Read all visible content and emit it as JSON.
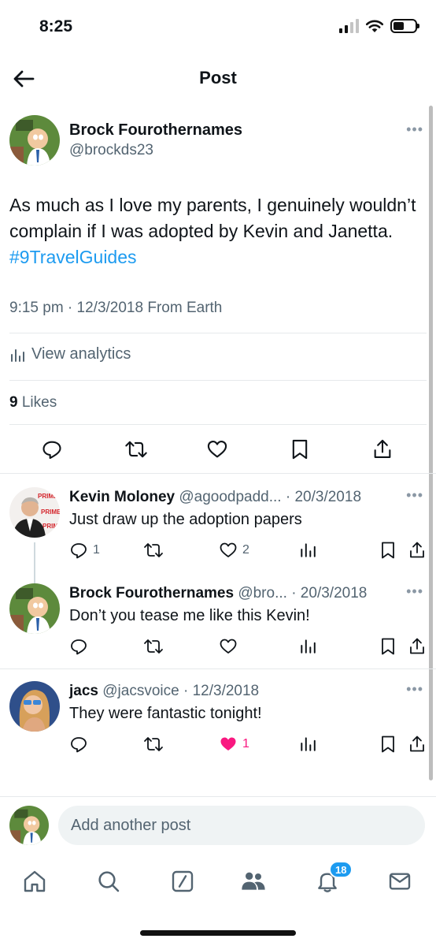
{
  "status_bar": {
    "time": "8:25",
    "signal_icon": "cellular-signal-icon",
    "wifi_icon": "wifi-icon",
    "battery_icon": "battery-icon"
  },
  "header": {
    "title": "Post",
    "back_icon": "arrow-left-icon"
  },
  "post": {
    "author_name": "Brock Fourothernames",
    "author_handle": "@brockds23",
    "text_before": "As much as I love my parents, I genuinely wouldn’t complain if I was adopted by Kevin and Janetta. ",
    "hashtag": "#9TravelGuides",
    "meta": "9:15 pm · 12/3/2018 From Earth",
    "analytics_label": "View analytics",
    "likes_count": "9",
    "likes_label": " Likes",
    "more_label": "•••"
  },
  "replies": [
    {
      "name": "Kevin Moloney",
      "handle": "@agoodpadd...",
      "date": " · 20/3/2018",
      "text": "Just draw up the adoption papers",
      "reply_count": "1",
      "like_count": "2",
      "liked": false,
      "more_label": "•••"
    },
    {
      "name": "Brock Fourothernames",
      "handle": "@bro...",
      "date": " · 20/3/2018",
      "text": "Don’t you tease me like this Kevin!",
      "reply_count": "",
      "like_count": "",
      "liked": false,
      "more_label": "•••"
    },
    {
      "name": "jacs",
      "handle": "@jacsvoice",
      "date": " · 12/3/2018",
      "text": "They were fantastic tonight!",
      "reply_count": "",
      "like_count": "1",
      "liked": true,
      "more_label": "•••"
    }
  ],
  "composer": {
    "placeholder": "Add another post"
  },
  "tabbar": {
    "notifications_badge": "18"
  },
  "colors": {
    "accent": "#1d9bf0",
    "like_active": "#f91880",
    "muted": "#536471",
    "text": "#0f1419"
  }
}
